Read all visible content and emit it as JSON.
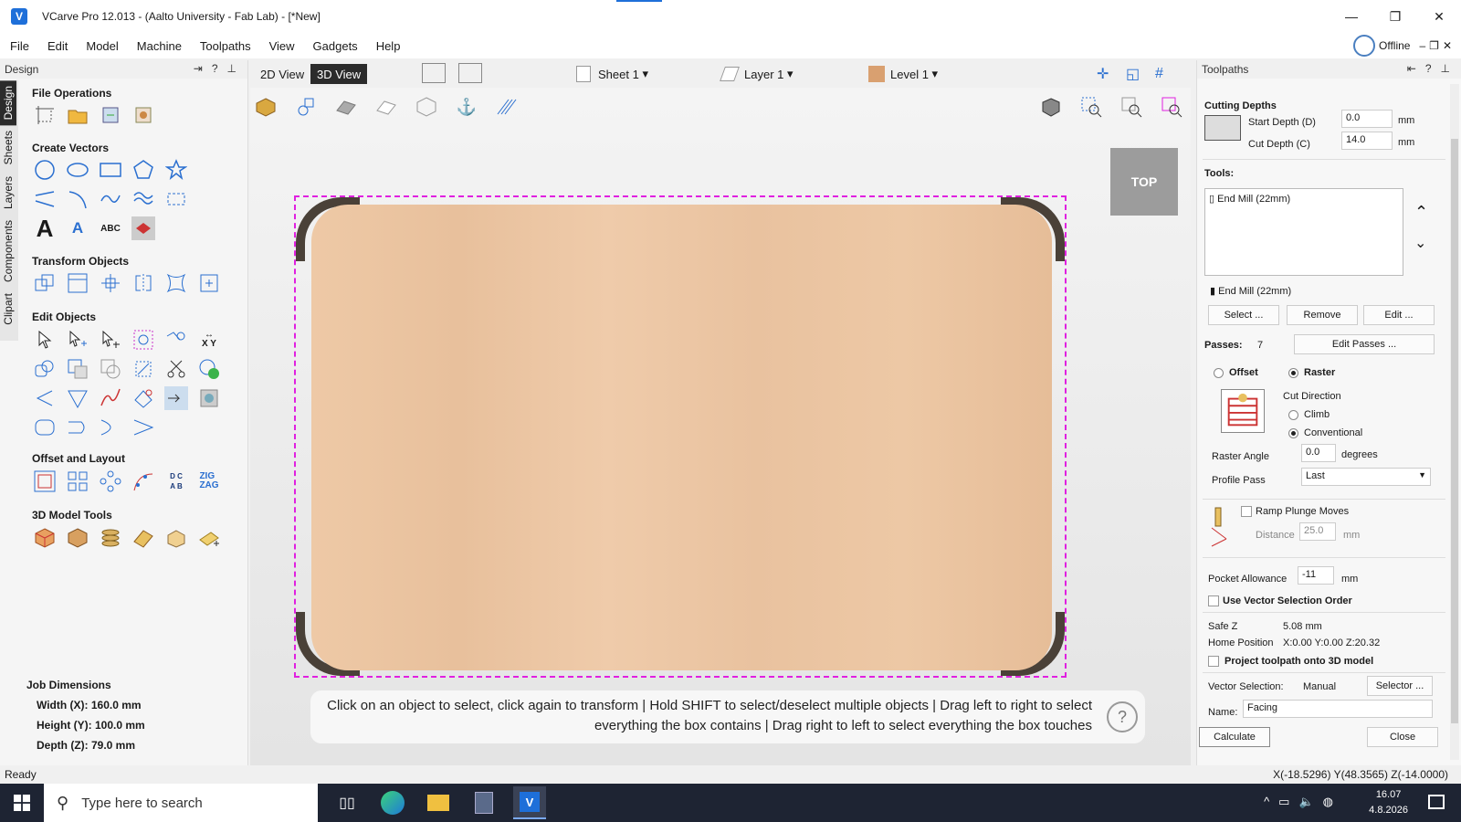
{
  "window": {
    "title": "VCarve Pro 12.013 - (Aalto University - Fab Lab) - [*New]",
    "min": "—",
    "restore": "❐",
    "close": "✕"
  },
  "menu": [
    "File",
    "Edit",
    "Model",
    "Machine",
    "Toolpaths",
    "View",
    "Gadgets",
    "Help"
  ],
  "offline": "Offline",
  "design_panel": {
    "title": "Design",
    "vtabs": [
      "Design",
      "Sheets",
      "Layers",
      "Components",
      "Clipart"
    ],
    "sections": [
      "File Operations",
      "Create Vectors",
      "Transform Objects",
      "Edit Objects",
      "Offset and Layout",
      "3D Model Tools"
    ]
  },
  "job": {
    "title": "Job Dimensions",
    "width": "Width  (X): 160.0 mm",
    "height": "Height (Y): 100.0 mm",
    "depth": "Depth  (Z): 79.0 mm"
  },
  "view": {
    "tab2d": "2D View",
    "tab3d": "3D View",
    "sheet": "Sheet 1",
    "layer": "Layer 1",
    "level": "Level 1",
    "top": "TOP"
  },
  "hint": {
    "line1": "Click on an object to select, click again to transform | Hold SHIFT to select/deselect multiple objects | Drag left to right to select",
    "line2": "everything the box contains | Drag right to left to select everything the box touches",
    "q": "?"
  },
  "toolpaths": {
    "title": "Toolpaths",
    "cutting_depths": "Cutting Depths",
    "start_depth_label": "Start Depth (D)",
    "start_depth": "0.0",
    "cut_depth_label": "Cut Depth (C)",
    "cut_depth": "14.0",
    "mm": "mm",
    "tools_label": "Tools:",
    "tool_item": "End Mill (22mm)",
    "tool_selected": "End Mill (22mm)",
    "select_btn": "Select ...",
    "remove_btn": "Remove",
    "edit_btn": "Edit ...",
    "passes_label": "Passes:",
    "passes": "7",
    "edit_passes_btn": "Edit Passes ...",
    "offset": "Offset",
    "raster": "Raster",
    "cut_direction": "Cut Direction",
    "climb": "Climb",
    "conventional": "Conventional",
    "raster_angle_label": "Raster Angle",
    "raster_angle": "0.0",
    "degrees": "degrees",
    "profile_pass_label": "Profile Pass",
    "profile_pass": "Last",
    "ramp": "Ramp Plunge Moves",
    "distance_label": "Distance",
    "distance": "25.0",
    "pocket_allowance_label": "Pocket Allowance",
    "pocket_allowance": "-11",
    "use_vector_order": "Use Vector Selection Order",
    "safe_z_label": "Safe Z",
    "safe_z": "5.08 mm",
    "home_label": "Home Position",
    "home": "X:0.00 Y:0.00 Z:20.32",
    "project": "Project toolpath onto 3D model",
    "vector_sel_label": "Vector Selection:",
    "vector_sel": "Manual",
    "selector_btn": "Selector ...",
    "name_label": "Name:",
    "name": "Facing",
    "calculate": "Calculate",
    "close": "Close"
  },
  "status": {
    "ready": "Ready",
    "coords": "X(-18.5296) Y(48.3565) Z(-14.0000)"
  },
  "taskbar": {
    "search_placeholder": "Type here to search",
    "time": "16.07",
    "date": "4.8.2026"
  },
  "colors": {
    "accent": "#1e6fd9",
    "selection": "#e020e0",
    "taskbar": "#1e2433"
  }
}
